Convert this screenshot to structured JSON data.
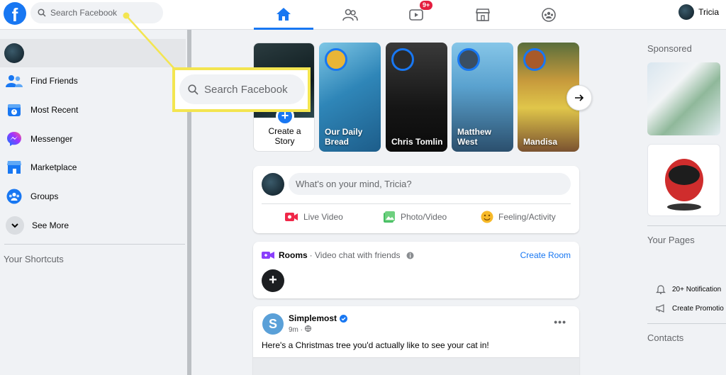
{
  "topbar": {
    "logo_letter": "f",
    "search_placeholder": "Search Facebook",
    "watch_badge": "9+",
    "user_name": "Tricia"
  },
  "sidebar": {
    "items": [
      {
        "label": "Find Friends",
        "icon": "friends-icon"
      },
      {
        "label": "Most Recent",
        "icon": "most-recent-icon"
      },
      {
        "label": "Messenger",
        "icon": "messenger-icon"
      },
      {
        "label": "Marketplace",
        "icon": "marketplace-icon"
      },
      {
        "label": "Groups",
        "icon": "groups-icon"
      },
      {
        "label": "See More",
        "icon": "chevron-down-icon"
      }
    ],
    "shortcuts_heading": "Your Shortcuts"
  },
  "callout": {
    "placeholder": "Search Facebook",
    "highlight_color": "#f3e550"
  },
  "stories": {
    "create_line1": "Create a",
    "create_line2": "Story",
    "items": [
      {
        "line1": "Our Daily",
        "line2": "Bread"
      },
      {
        "line1": "Chris Tomlin",
        "line2": ""
      },
      {
        "line1": "Matthew",
        "line2": "West"
      },
      {
        "line1": "Mandisa",
        "line2": ""
      }
    ]
  },
  "composer": {
    "placeholder": "What's on your mind, Tricia?",
    "actions": [
      "Live Video",
      "Photo/Video",
      "Feeling/Activity"
    ]
  },
  "rooms": {
    "label": "Rooms",
    "subtitle": "· Video chat with friends",
    "create_label": "Create Room"
  },
  "post": {
    "author": "Simplemost",
    "time": "9m · ",
    "text": "Here's a Christmas tree you'd actually like to see your cat in!"
  },
  "right": {
    "sponsored": "Sponsored",
    "your_pages": "Your Pages",
    "notifications": "20+ Notification",
    "create_promotion": "Create Promotio",
    "contacts": "Contacts"
  },
  "colors": {
    "brand": "#1877f2",
    "badge": "#e41e3f",
    "highlight": "#f3e550"
  }
}
